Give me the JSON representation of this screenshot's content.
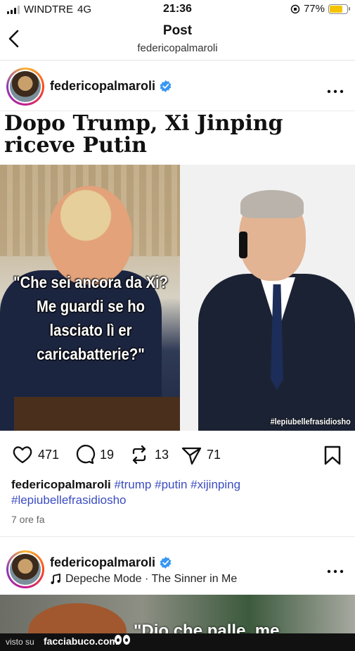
{
  "status_bar": {
    "carrier": "WINDTRE",
    "network": "4G",
    "time": "21:36",
    "battery_percent": "77%",
    "battery_level": 0.77,
    "battery_color": "#f5c400"
  },
  "header": {
    "title": "Post",
    "subtitle": "federicopalmaroli",
    "back_icon": "chevron-left-icon"
  },
  "post": {
    "username": "federicopalmaroli",
    "verified_color": "#3897f0",
    "more_icon": "more-horizontal-icon",
    "title": "Dopo Trump, Xi Jinping riceve Putin",
    "image": {
      "quote": "\"Che sei ancora da Xi? Me guardi se ho lasciato lì er caricabatterie?\"",
      "watermark": "#lepiubellefrasidiosho"
    },
    "actions": {
      "likes": "471",
      "comments": "19",
      "reposts": "13",
      "shares": "71"
    },
    "caption": {
      "username": "federicopalmaroli",
      "tags": [
        "#trump",
        "#putin",
        "#xijinping",
        "#lepiubellefrasidiosho"
      ]
    },
    "time_ago": "7 ore fa"
  },
  "next_post": {
    "username": "federicopalmaroli",
    "music": "Depeche Mode · The Sinner in Me",
    "quote_fragment": "\"Dio che palle, me"
  },
  "footer": {
    "visto_su": "visto su",
    "site": "facciabuco.com"
  }
}
